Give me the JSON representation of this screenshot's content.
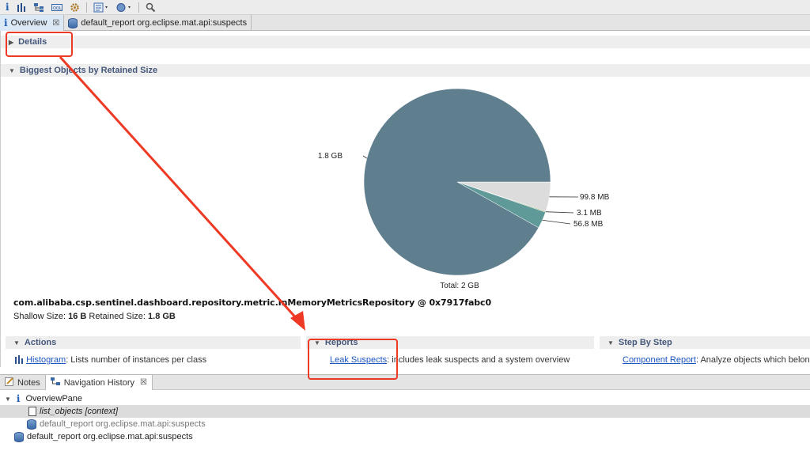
{
  "toolbar": {
    "buttons": [
      "info-icon",
      "histogram-icon",
      "dominator-tree-icon",
      "oql-icon",
      "gear-icon",
      "heap-dump-menu-icon",
      "reports-menu-icon",
      "search-icon"
    ]
  },
  "editor_tabs": [
    {
      "label": "Overview",
      "active": true
    },
    {
      "label": "default_report  org.eclipse.mat.api:suspects",
      "active": false
    }
  ],
  "sections": {
    "details": "Details",
    "biggest": "Biggest Objects by Retained Size",
    "actions": "Actions",
    "reports": "Reports",
    "step_by_step": "Step By Step"
  },
  "chart_data": {
    "type": "pie",
    "title": "",
    "total_label": "Total: 2 GB",
    "slices": [
      {
        "label": "1.8 GB",
        "value": 1.8,
        "unit": "GB",
        "color": "#5f7f8f"
      },
      {
        "label": "99.8 MB",
        "value": 0.0998,
        "unit": "GB",
        "color": "#dcdcdc"
      },
      {
        "label": "3.1 MB",
        "value": 0.0031,
        "unit": "GB",
        "color": "#8aa86a"
      },
      {
        "label": "56.8 MB",
        "value": 0.0568,
        "unit": "GB",
        "color": "#5f9a98"
      }
    ]
  },
  "object": {
    "name": "com.alibaba.csp.sentinel.dashboard.repository.metric.InMemoryMetricsRepository @ 0x7917fabc0",
    "shallow_label": "Shallow Size:",
    "shallow_value": "16 B",
    "retained_label": "Retained Size:",
    "retained_value": "1.8 GB"
  },
  "actions": {
    "histogram_link": "Histogram",
    "histogram_desc": ": Lists number of instances per class"
  },
  "reports": {
    "leak_link": "Leak Suspects",
    "leak_desc": ": includes leak suspects and a system overview"
  },
  "steps": {
    "component_link": "Component Report",
    "component_desc": ": Analyze objects which belong"
  },
  "view_tabs": [
    {
      "label": "Notes",
      "active": false
    },
    {
      "label": "Navigation History",
      "active": true
    }
  ],
  "history": [
    {
      "label": "OverviewPane",
      "indent": 0
    },
    {
      "label": "list_objects [context]",
      "indent": 1
    },
    {
      "label": "default_report  org.eclipse.mat.api:suspects",
      "indent": 1
    },
    {
      "label": "default_report  org.eclipse.mat.api:suspects",
      "indent": 0
    }
  ],
  "colors": {
    "annotation": "#ee3a24",
    "link": "#1a55c0",
    "section_text": "#45577a"
  }
}
